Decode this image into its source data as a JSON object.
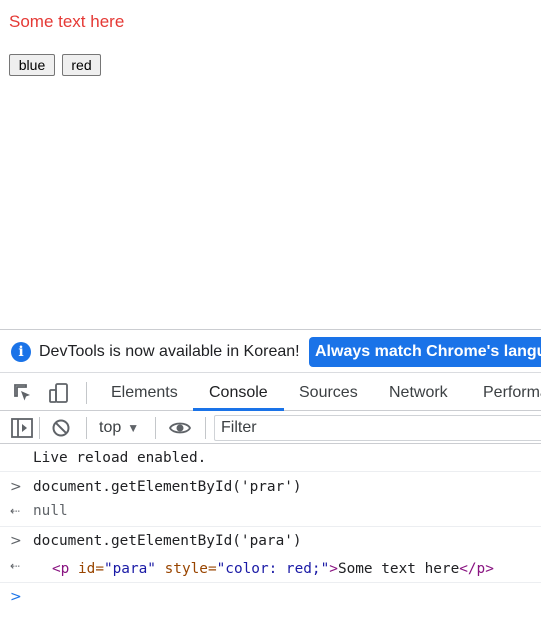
{
  "page": {
    "text": "Some text here",
    "text_color": "#e53935",
    "buttons": {
      "blue": "blue",
      "red": "red"
    }
  },
  "devtools": {
    "infobar": {
      "message": "DevTools is now available in Korean!",
      "match_button": "Always match Chrome's language"
    },
    "tabs": {
      "elements": "Elements",
      "console": "Console",
      "sources": "Sources",
      "network": "Network",
      "performance": "Performance"
    },
    "toolbar": {
      "context": "top",
      "filter_placeholder": "Filter"
    },
    "console": {
      "live_reload": "Live reload enabled.",
      "commands": [
        {
          "input": "document.getElementById('prar')",
          "result": "null"
        },
        {
          "input": "document.getElementById('para')"
        }
      ],
      "element_result": {
        "open_tag_start": "<p",
        "attr1_name": " id=",
        "attr1_value": "\"para\"",
        "attr2_name": " style=",
        "attr2_value": "\"color: red;\"",
        "open_tag_end": ">",
        "text": "Some text here",
        "close_tag": "</p>"
      }
    },
    "colors": {
      "accent": "#1a73e8",
      "tag": "#881280",
      "attr_name": "#994500",
      "attr_value": "#1a1aa6"
    }
  }
}
